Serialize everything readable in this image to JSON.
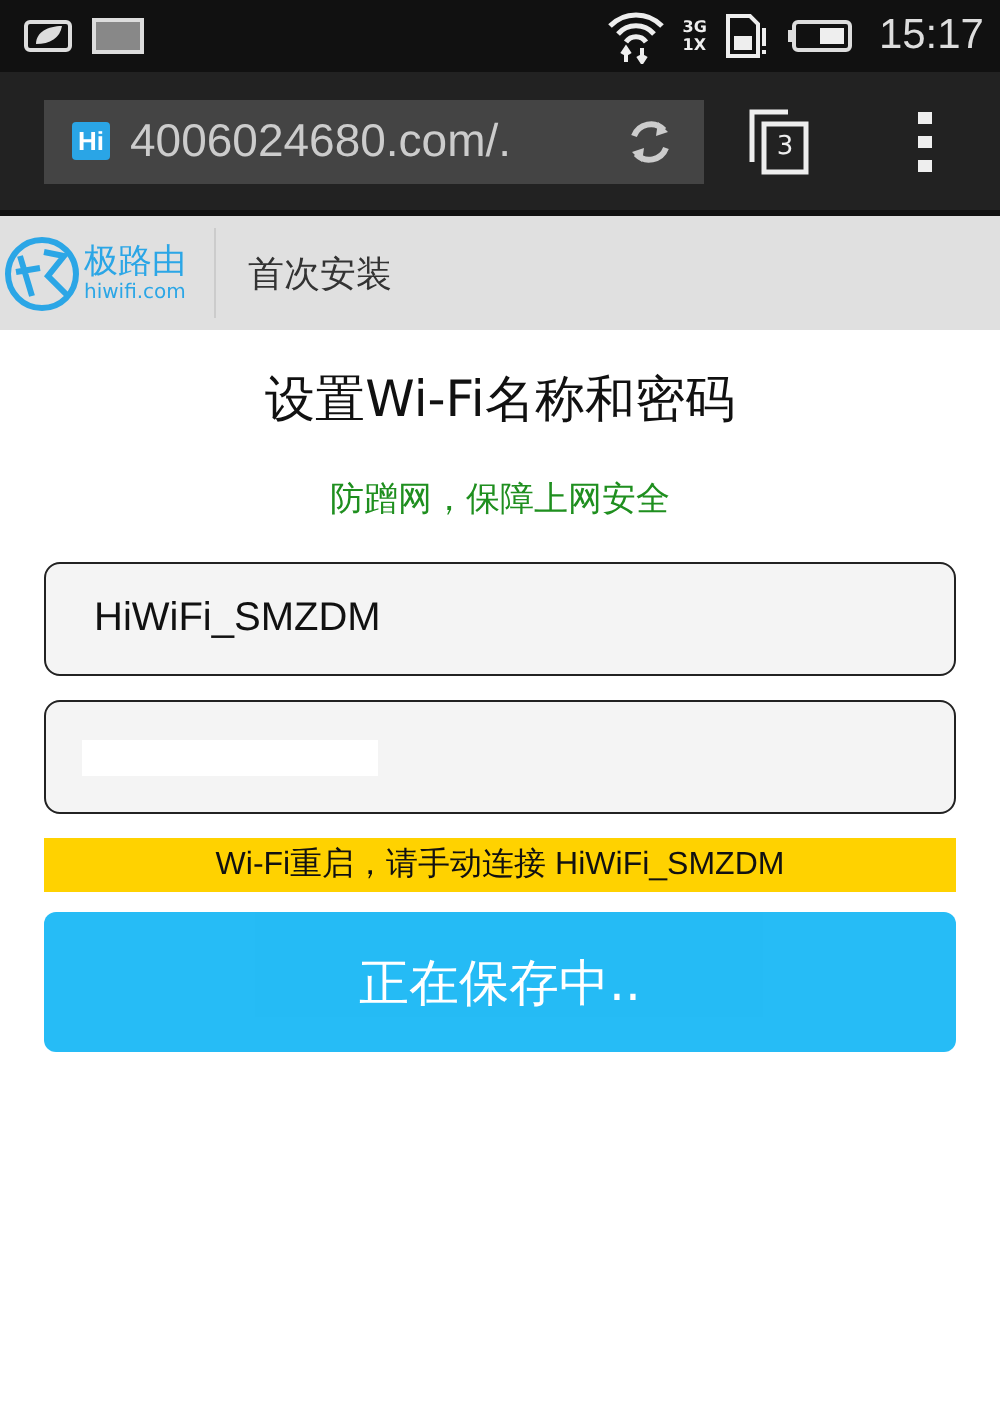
{
  "status_bar": {
    "network_3g": "3G",
    "network_1x": "1X",
    "time": "15:17"
  },
  "browser": {
    "favicon": "Hi",
    "url": "4006024680.com/.",
    "tab_count": "3"
  },
  "header": {
    "logo_name": "极路由",
    "logo_domain": "hiwifi.com",
    "title": "首次安装"
  },
  "page": {
    "heading": "设置Wi-Fi名称和密码",
    "subtitle": "防蹭网，保障上网安全",
    "fields": [
      {
        "value": "HiWiFi_SMZDM",
        "redacted": false
      },
      {
        "redacted": true
      }
    ],
    "notice": "Wi-Fi重启，请手动连接 HiWiFi_SMZDM",
    "save_button": {
      "label": "正在保存中..",
      "disabled": true
    }
  }
}
